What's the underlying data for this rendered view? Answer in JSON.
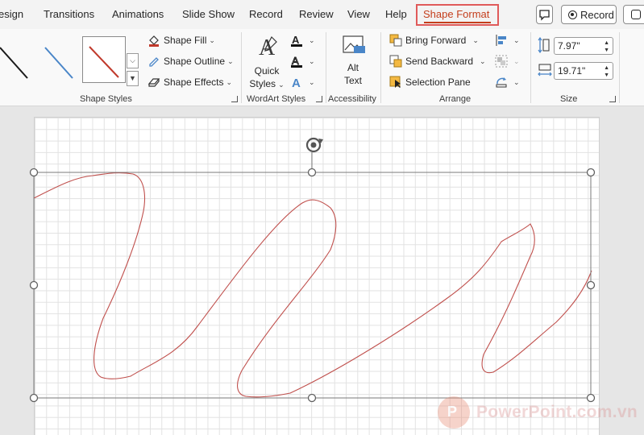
{
  "tabs": [
    {
      "label": "esign",
      "active": false
    },
    {
      "label": "Transitions",
      "active": false
    },
    {
      "label": "Animations",
      "active": false
    },
    {
      "label": "Slide Show",
      "active": false
    },
    {
      "label": "Record",
      "active": false
    },
    {
      "label": "Review",
      "active": false
    },
    {
      "label": "View",
      "active": false
    },
    {
      "label": "Help",
      "active": false
    },
    {
      "label": "Shape Format",
      "active": true
    }
  ],
  "title_actions": {
    "comment_icon": "comment-icon",
    "record_label": "Record",
    "present_icon": "present-icon"
  },
  "ribbon": {
    "shape_styles": {
      "label": "Shape Styles",
      "fill_label": "Shape Fill",
      "outline_label": "Shape Outline",
      "effects_label": "Shape Effects",
      "gallery": [
        {
          "style": "black-line",
          "color": "#1a1a1a"
        },
        {
          "style": "blue-line",
          "color": "#4a86c8"
        },
        {
          "style": "red-line",
          "color": "#c0392b",
          "selected": true
        }
      ]
    },
    "wordart": {
      "label": "WordArt Styles",
      "quick_styles_line1": "Quick",
      "quick_styles_line2": "Styles",
      "text_fill_icon": "text-fill-icon",
      "text_outline_icon": "text-outline-icon",
      "text_effects_icon": "text-effects-icon"
    },
    "accessibility": {
      "label": "Accessibility",
      "alt_text_line1": "Alt",
      "alt_text_line2": "Text"
    },
    "arrange": {
      "label": "Arrange",
      "bring_forward": "Bring Forward",
      "send_backward": "Send Backward",
      "selection_pane": "Selection Pane",
      "align_icon": "align-icon",
      "group_icon": "group-icon",
      "rotate_icon": "rotate-icon"
    },
    "size": {
      "label": "Size",
      "height": "7.97\"",
      "width": "19.71\""
    }
  },
  "canvas": {
    "selected_shape": "freeform-scribble",
    "line_color": "#c0504d",
    "handle_color": "#606060"
  },
  "watermark": {
    "logo_letter": "P",
    "text": "PowerPoint.com.vn"
  }
}
